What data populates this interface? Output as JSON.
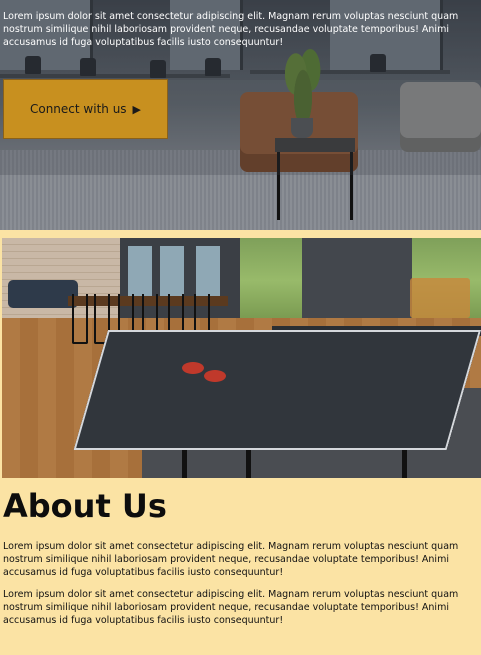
{
  "hero": {
    "paragraph": "Lorem ipsum dolor sit amet consectetur adipiscing elit. Magnam rerum voluptas nesciunt quam nostrum similique nihil laboriosam provident neque, recusandae voluptate temporibus! Animi accusamus id fuga voluptatibus facilis iusto consequuntur!",
    "button_label": "Connect with us",
    "button_icon": "play-triangle-icon",
    "accent_color": "#c8901f"
  },
  "about": {
    "title": "About Us",
    "paragraphs": [
      "Lorem ipsum dolor sit amet consectetur adipiscing elit. Magnam rerum voluptas nesciunt quam nostrum similique nihil laboriosam provident neque, recusandae voluptate temporibus! Animi accusamus id fuga voluptatibus facilis iusto consequuntur!",
      "Lorem ipsum dolor sit amet consectetur adipiscing elit. Magnam rerum voluptas nesciunt quam nostrum similique nihil laboriosam provident neque, recusandae voluptate temporibus! Animi accusamus id fuga voluptatibus facilis iusto consequuntur!"
    ],
    "background_color": "#fbe3a4"
  }
}
